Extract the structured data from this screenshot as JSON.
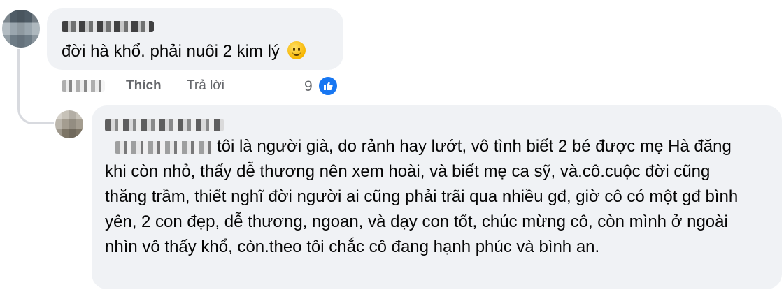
{
  "comments": [
    {
      "text": "đời hà khổ. phải nuôi 2 kim lý",
      "emoji": "slightly-smiling-face-icon",
      "actions": {
        "like": "Thích",
        "reply": "Trả lời"
      },
      "reaction_count": "9",
      "reaction_icon": "like-thumb-icon"
    },
    {
      "text": "tôi là người già, do rảnh hay lướt, vô tình biết 2 bé được mẹ Hà đăng khi còn nhỏ, thấy dễ thương nên xem hoài, và biết mẹ ca sỹ, và.cô.cuộc đời cũng thăng trầm, thiết nghĩ đời người ai cũng phải trãi qua nhiều gđ, giờ cô có một gđ bình yên, 2 con đẹp, dễ thương, ngoan, và dạy con tốt, chúc mừng cô, còn mình ở ngoài nhìn vô thấy khổ, còn.theo tôi chắc cô đang hạnh phúc và bình an."
    }
  ],
  "colors": {
    "bubble": "#f0f2f5",
    "meta_text": "#65676b",
    "like_blue": "#1877f2"
  }
}
